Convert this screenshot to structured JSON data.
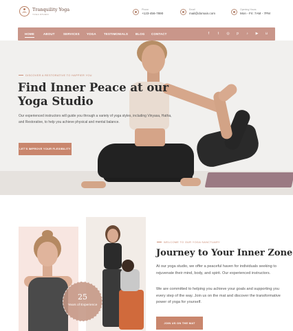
{
  "brand": {
    "name": "Tranquility Yoga",
    "tagline": "YOGA STUDIO"
  },
  "contact": {
    "phone": {
      "label": "Phone",
      "value": "+123-456-7890"
    },
    "email": {
      "label": "Email",
      "value": "mail@domain.com"
    },
    "hours": {
      "label": "Opening Hours",
      "value": "Mon - Fri: 7AM - 7PM"
    }
  },
  "nav": {
    "items": [
      "HOME",
      "ABOUT",
      "SERVICES",
      "YOGA",
      "TESTIMONIALS",
      "BLOG",
      "CONTACT"
    ],
    "icons": [
      "facebook-icon",
      "twitter-icon",
      "instagram-icon",
      "pinterest-icon",
      "tiktok-icon",
      "youtube-icon",
      "cart-icon",
      "search-icon"
    ]
  },
  "hero": {
    "eyebrow": "DISCOVER A RESTORATIVE TO HAPPIER YOU",
    "title": "Find Inner Peace at our Yoga Studio",
    "text": "Our experienced instructors will guide you through a variety of yoga styles, including Vinyasa, Hatha, and Restorative, to help you achieve physical and mental balance.",
    "button": "LET'S IMPROVE YOUR FLEXIBILITY"
  },
  "about": {
    "eyebrow": "WELCOME TO OUR YOGA SANCTUARY",
    "title": "Journey to Your Inner Zone",
    "p1": "At our yoga studio, we offer a peaceful haven for individuals seeking to rejuvenate their mind, body, and spirit. Our experienced instructors.",
    "p2": "We are committed to helping you achieve your goals and supporting you every step of the way. Join us on the mat and discover the transformative power of yoga for yourself.",
    "button": "JOIN US ON THE MAT",
    "badge": {
      "number": "25",
      "label": "Years of Experience"
    }
  },
  "colors": {
    "accent": "#c9866d",
    "nav": "#c9968a"
  }
}
